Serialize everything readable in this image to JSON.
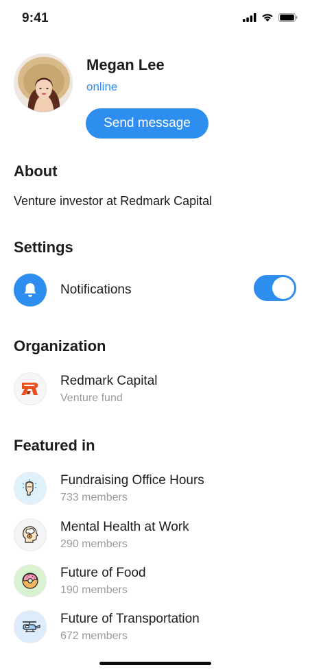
{
  "status_bar": {
    "time": "9:41"
  },
  "profile": {
    "name": "Megan Lee",
    "status": "online",
    "send_button_label": "Send message"
  },
  "about": {
    "title": "About",
    "text": "Venture investor at Redmark Capital"
  },
  "settings": {
    "title": "Settings",
    "notifications_label": "Notifications",
    "notifications_enabled": true
  },
  "organization": {
    "title": "Organization",
    "name": "Redmark Capital",
    "type": "Venture fund"
  },
  "featured": {
    "title": "Featured in",
    "items": [
      {
        "title": "Fundraising Office Hours",
        "members": "733 members",
        "icon": "raised-fist-icon"
      },
      {
        "title": "Mental Health at Work",
        "members": "290 members",
        "icon": "head-brain-icon"
      },
      {
        "title": "Future of Food",
        "members": "190 members",
        "icon": "donut-icon"
      },
      {
        "title": "Future of Transportation",
        "members": "672 members",
        "icon": "helicopter-icon"
      }
    ]
  },
  "colors": {
    "accent": "#2e8ef0",
    "secondary_text": "#9a9aa0",
    "brand_orange": "#e9501e"
  }
}
